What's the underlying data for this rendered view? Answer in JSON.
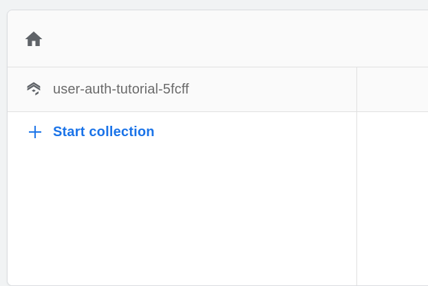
{
  "topbar": {
    "home_icon": "home-icon"
  },
  "database": {
    "icon": "firestore-layers-icon",
    "name": "user-auth-tutorial-5fcff"
  },
  "actions": {
    "start_collection_icon": "plus-icon",
    "start_collection_label": "Start collection"
  },
  "colors": {
    "accent": "#1a73e8",
    "icon_gray": "#5f6368",
    "text_gray": "#6a6a6a",
    "divider": "#e0e0e0",
    "header_bg": "#fafafa"
  }
}
